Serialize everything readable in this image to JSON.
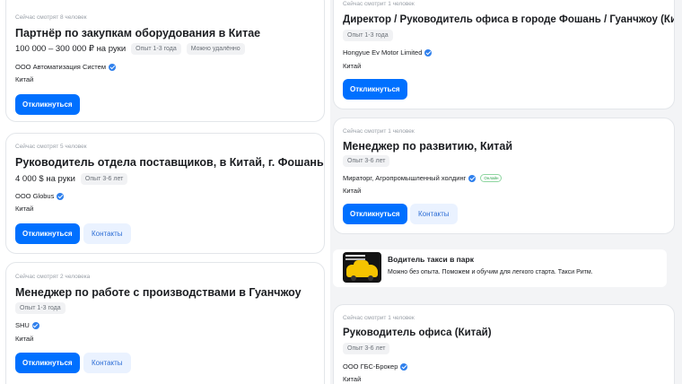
{
  "left_column": {
    "cards": [
      {
        "viewers": "Сейчас смотрят 8 человек",
        "title": "Партнёр по закупкам оборудования в Китае",
        "salary": "100 000 – 300 000 ₽ на руки",
        "chips": [
          "Опыт 1-3 года",
          "Можно удалённо"
        ],
        "company": "ООО Автоматизация Систем",
        "location": "Китай",
        "apply_label": "Откликнуться"
      },
      {
        "viewers": "Сейчас смотрят 5 человек",
        "title": "Руководитель отдела поставщиков, в Китай, г. Фошань",
        "salary": "4 000 $ на руки",
        "chips": [
          "Опыт 3-6 лет"
        ],
        "company": "ООО Globus",
        "location": "Китай",
        "apply_label": "Откликнуться",
        "contacts_label": "Контакты"
      },
      {
        "viewers": "Сейчас смотрят 2 человека",
        "title": "Менеджер по работе с производствами в Гуанчжоу",
        "chips": [
          "Опыт 1-3 года"
        ],
        "company": "SHU",
        "location": "Китай",
        "apply_label": "Откликнуться",
        "contacts_label": "Контакты"
      }
    ]
  },
  "right_column": {
    "cards": [
      {
        "viewers": "Сейчас смотрит 1 человек",
        "title": "Директор / Руководитель офиса в городе Фошань / Гуанчжоу (Китай)",
        "chips": [
          "Опыт 1-3 года"
        ],
        "company": "Hongyue Ev Motor Limited",
        "location": "Китай",
        "apply_label": "Откликнуться"
      },
      {
        "viewers": "Сейчас смотрит 1 человек",
        "title": "Менеджер по развитию, Китай",
        "chips": [
          "Опыт 3-6 лет"
        ],
        "company": "Мираторг, Агропромышленный холдинг",
        "company_badge": "Онлайн",
        "location": "Китай",
        "apply_label": "Откликнуться",
        "contacts_label": "Контакты"
      },
      {
        "viewers": "Сейчас смотрит 1 человек",
        "title": "Руководитель офиса (Китай)",
        "chips": [
          "Опыт 3-6 лет"
        ],
        "company": "ООО ГБС-Брокер",
        "location": "Китай"
      }
    ],
    "ad": {
      "title": "Водитель такси в парк",
      "text": "Можно без опыта. Поможем и обучим для легкого старта. Такси Ритм."
    }
  },
  "colors": {
    "accent": "#0070ff",
    "contacts_bg": "#eaf2ff",
    "verified": "#2f80ed",
    "right_bg": "#f3f4f6"
  },
  "icons": [
    "verified-check-icon",
    "taxi-car-image"
  ]
}
